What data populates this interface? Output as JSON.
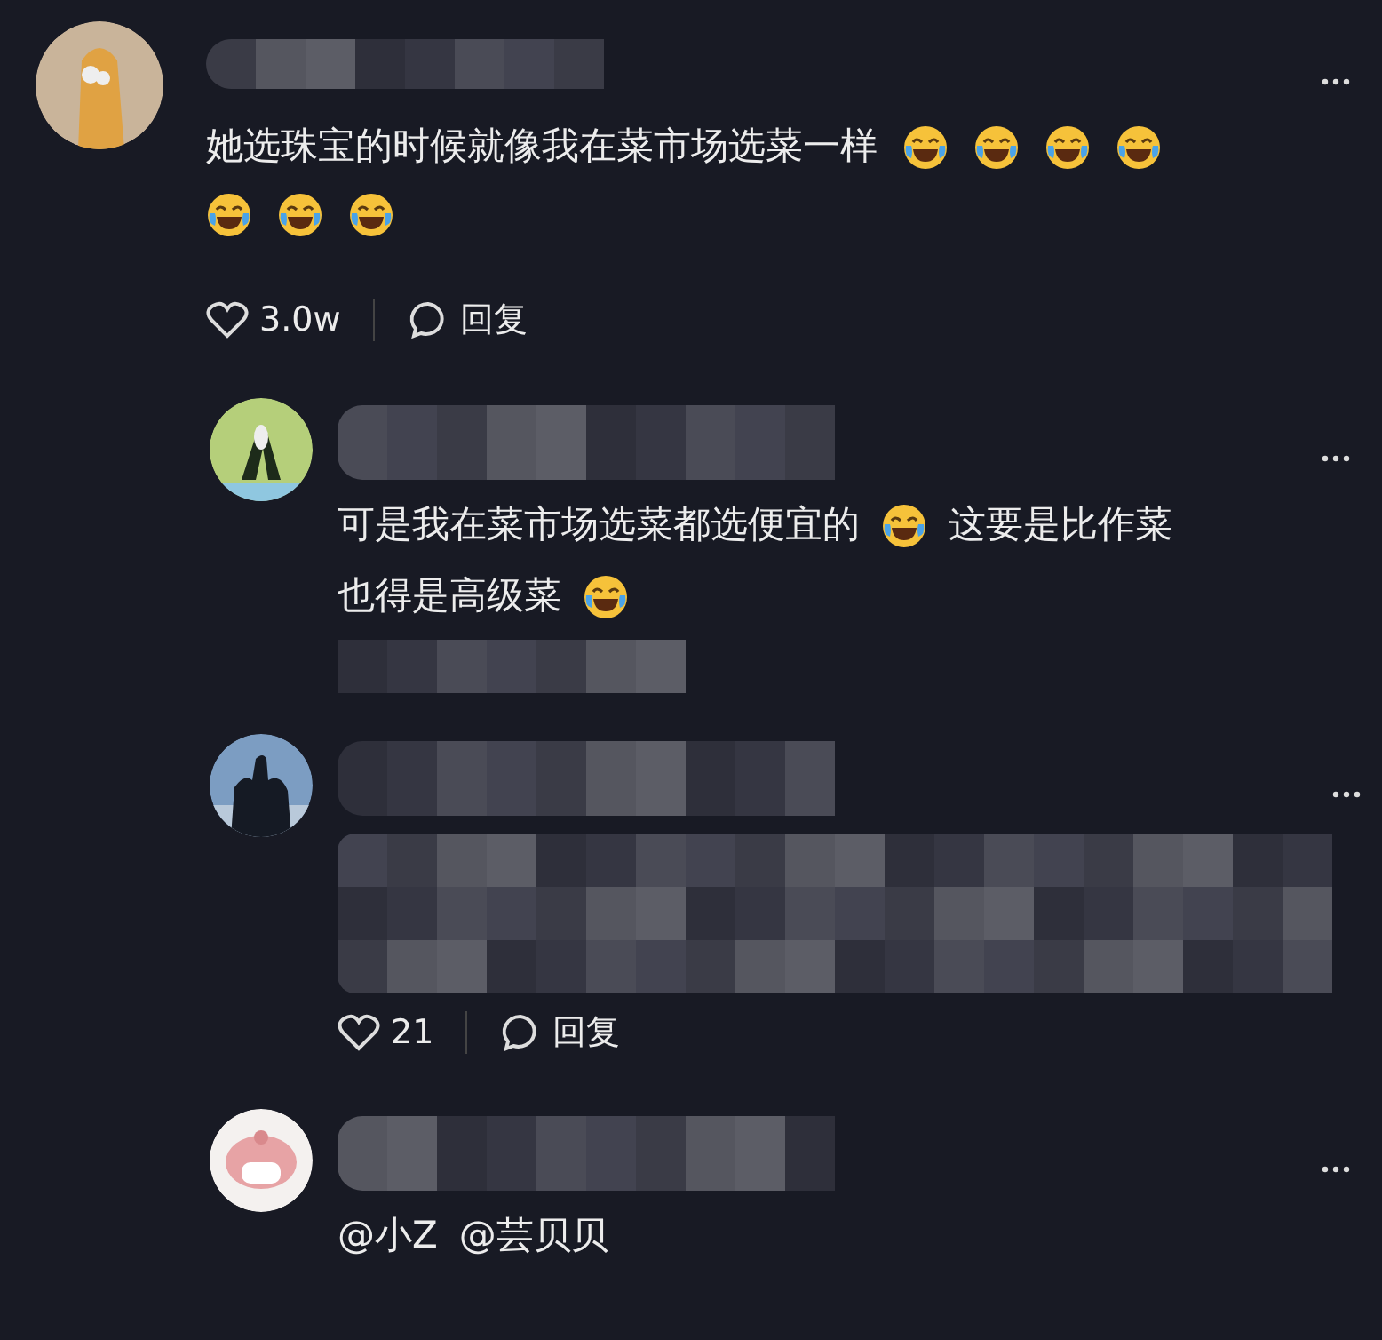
{
  "comments": [
    {
      "name_blurred": true,
      "lines": [
        [
          {
            "kind": "text",
            "text": "她选珠宝的时候就像我在菜市场选菜一样"
          },
          {
            "kind": "emoji"
          },
          {
            "kind": "emoji"
          },
          {
            "kind": "emoji"
          },
          {
            "kind": "emoji"
          }
        ],
        [
          {
            "kind": "emoji"
          },
          {
            "kind": "emoji"
          },
          {
            "kind": "emoji"
          }
        ]
      ],
      "likes": "3.0w",
      "reply": "回复",
      "children": [
        {
          "name_blurred": true,
          "lines": [
            [
              {
                "kind": "text",
                "text": "可是我在菜市场选菜都选便宜的"
              },
              {
                "kind": "emoji"
              },
              {
                "kind": "text",
                "text": "这要是比作菜"
              }
            ],
            [
              {
                "kind": "text",
                "text": "也得是高级菜"
              },
              {
                "kind": "emoji"
              }
            ]
          ],
          "footer_blurred": true
        },
        {
          "name_blurred": true,
          "body_blurred": true,
          "likes": "21",
          "reply": "回复"
        },
        {
          "name_blurred": true,
          "lines": [
            [
              {
                "kind": "text",
                "text": "@小Z"
              },
              {
                "kind": "text",
                "text": "@芸贝贝"
              }
            ]
          ]
        }
      ]
    }
  ]
}
